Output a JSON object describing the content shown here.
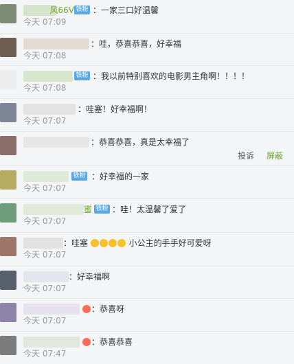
{
  "comments": [
    {
      "nickname": "风66V",
      "badge": "铁粉",
      "text": "：一家三口好温馨",
      "time": "今天 07:09"
    },
    {
      "text": "：哇，恭喜恭喜，好幸福",
      "time": "今天 07:08"
    },
    {
      "badge": "铁粉",
      "text": "：我以前特别喜欢的电影男主角啊！！！！",
      "time": "今天 07:08"
    },
    {
      "text": "：哇塞！好幸福啊！",
      "time": "今天 07:07"
    },
    {
      "text": "：恭喜恭喜，真是太幸福了",
      "time": "今天 07:07"
    },
    {
      "badge": "铁粉",
      "text": "：好幸福的一家",
      "time": "今天 07:07"
    },
    {
      "badge": "铁粉",
      "name_suffix": "蜜",
      "text": "：哇！太温馨了爱了",
      "time": "今天 07:07"
    },
    {
      "text": "：哇塞",
      "text_after": "小公主的手手好可爱呀",
      "time": "今天 07:07"
    },
    {
      "text": "：好幸福啊",
      "time": "今天 07:07"
    },
    {
      "text": "：恭喜呀",
      "time": "今天 07:07"
    },
    {
      "text": "：恭喜恭喜",
      "time": "今天 07:47"
    }
  ],
  "actions": {
    "report": "投诉",
    "block": "屏蔽"
  },
  "colors": {
    "accent_green": "#6aa52b",
    "badge_blue": "#5aa9e6",
    "time_gray": "#999999"
  }
}
